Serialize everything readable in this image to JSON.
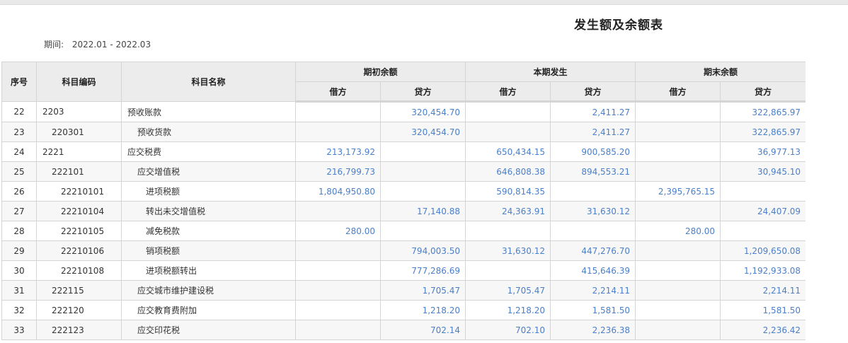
{
  "title": "发生额及余额表",
  "period": {
    "label": "期间:",
    "value": "2022.01 - 2022.03"
  },
  "headers": {
    "no": "序号",
    "code": "科目编码",
    "name": "科目名称",
    "opening": "期初余额",
    "current": "本期发生",
    "closing": "期末余额",
    "debit": "借方",
    "credit": "贷方"
  },
  "rows": [
    {
      "no": "22",
      "code": "2203",
      "name": "预收账款",
      "level": 1,
      "od": "",
      "oc": "320,454.70",
      "cd": "",
      "cc": "2,411.27",
      "ed": "",
      "ec": "322,865.97"
    },
    {
      "no": "23",
      "code": "220301",
      "name": "预收货款",
      "level": 2,
      "od": "",
      "oc": "320,454.70",
      "cd": "",
      "cc": "2,411.27",
      "ed": "",
      "ec": "322,865.97"
    },
    {
      "no": "24",
      "code": "2221",
      "name": "应交税费",
      "level": 1,
      "od": "213,173.92",
      "oc": "",
      "cd": "650,434.15",
      "cc": "900,585.20",
      "ed": "",
      "ec": "36,977.13"
    },
    {
      "no": "25",
      "code": "222101",
      "name": "应交增值税",
      "level": 2,
      "od": "216,799.73",
      "oc": "",
      "cd": "646,808.38",
      "cc": "894,553.21",
      "ed": "",
      "ec": "30,945.10"
    },
    {
      "no": "26",
      "code": "22210101",
      "name": "进项税额",
      "level": 3,
      "od": "1,804,950.80",
      "oc": "",
      "cd": "590,814.35",
      "cc": "",
      "ed": "2,395,765.15",
      "ec": ""
    },
    {
      "no": "27",
      "code": "22210104",
      "name": "转出未交增值税",
      "level": 3,
      "od": "",
      "oc": "17,140.88",
      "cd": "24,363.91",
      "cc": "31,630.12",
      "ed": "",
      "ec": "24,407.09"
    },
    {
      "no": "28",
      "code": "22210105",
      "name": "减免税款",
      "level": 3,
      "od": "280.00",
      "oc": "",
      "cd": "",
      "cc": "",
      "ed": "280.00",
      "ec": ""
    },
    {
      "no": "29",
      "code": "22210106",
      "name": "销项税额",
      "level": 3,
      "od": "",
      "oc": "794,003.50",
      "cd": "31,630.12",
      "cc": "447,276.70",
      "ed": "",
      "ec": "1,209,650.08"
    },
    {
      "no": "30",
      "code": "22210108",
      "name": "进项税额转出",
      "level": 3,
      "od": "",
      "oc": "777,286.69",
      "cd": "",
      "cc": "415,646.39",
      "ed": "",
      "ec": "1,192,933.08"
    },
    {
      "no": "31",
      "code": "222115",
      "name": "应交城市维护建设税",
      "level": 2,
      "od": "",
      "oc": "1,705.47",
      "cd": "1,705.47",
      "cc": "2,214.11",
      "ed": "",
      "ec": "2,214.11"
    },
    {
      "no": "32",
      "code": "222120",
      "name": "应交教育费附加",
      "level": 2,
      "od": "",
      "oc": "1,218.20",
      "cd": "1,218.20",
      "cc": "1,581.50",
      "ed": "",
      "ec": "1,581.50"
    },
    {
      "no": "33",
      "code": "222123",
      "name": "应交印花税",
      "level": 2,
      "od": "",
      "oc": "702.14",
      "cd": "702.10",
      "cc": "2,236.38",
      "ed": "",
      "ec": "2,236.42"
    }
  ]
}
